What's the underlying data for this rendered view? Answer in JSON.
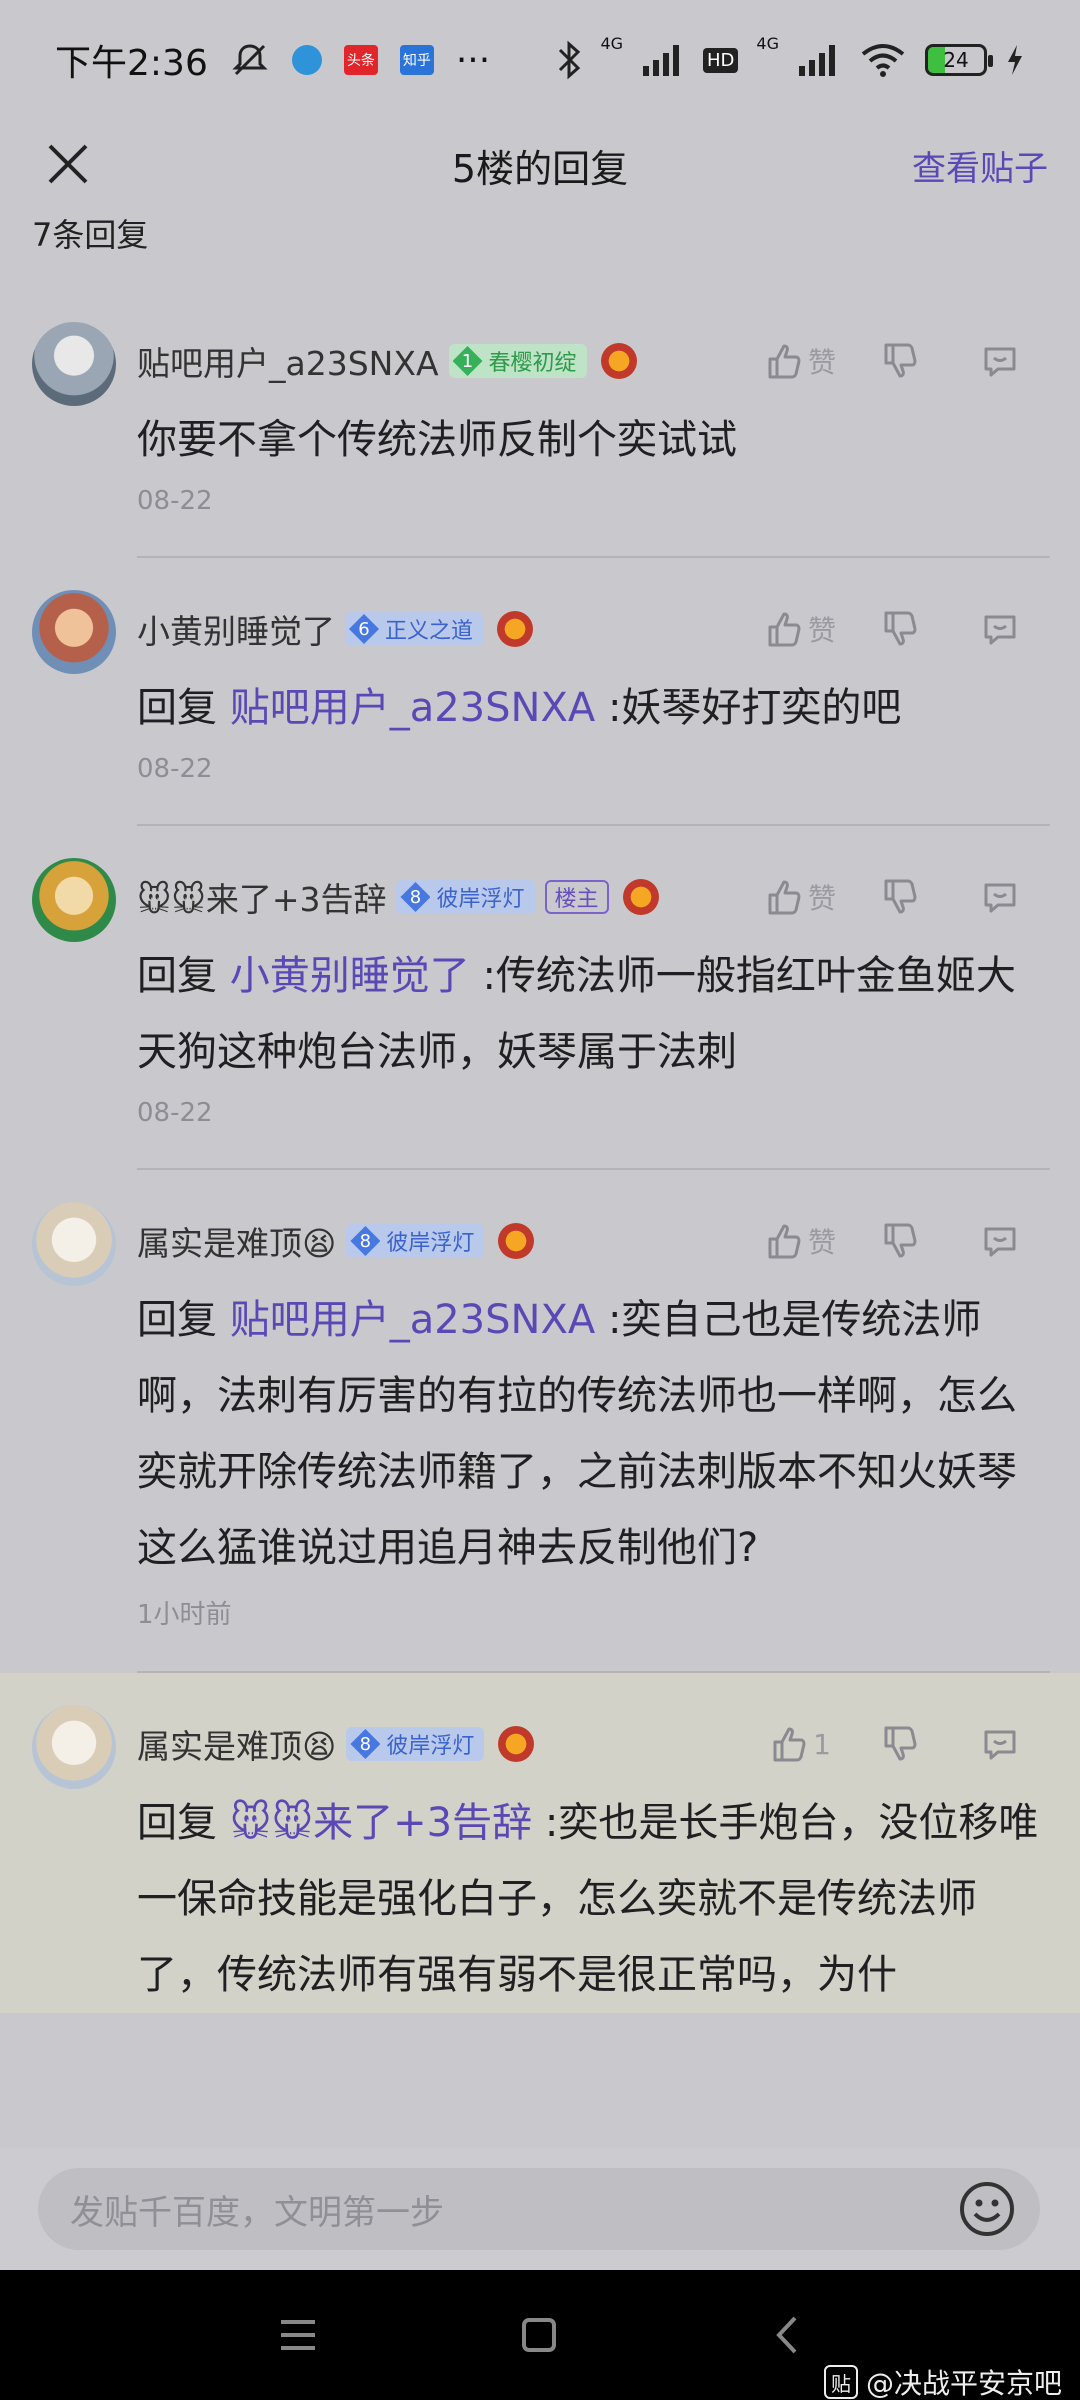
{
  "status_bar": {
    "time": "下午2:36",
    "app_badges": [
      "头条",
      "知乎"
    ],
    "overflow": "···",
    "network_1": "4G",
    "network_2": "4G",
    "hd": "HD",
    "battery": "24"
  },
  "header": {
    "title": "5楼的回复",
    "view_post": "查看贴子",
    "close_icon": "close-icon"
  },
  "reply_count": "7条回复",
  "like_label": "赞",
  "comments": [
    {
      "username": "贴吧用户_a23SNXA",
      "level": "1",
      "badge": "春樱初绽",
      "badge_style": "green",
      "owner": "",
      "reply_prefix": "",
      "mention": "",
      "text": "你要不拿个传统法师反制个奕试试",
      "time": "08-22",
      "likes": ""
    },
    {
      "username": "小黄别睡觉了",
      "level": "6",
      "badge": "正义之道",
      "badge_style": "blue",
      "owner": "",
      "reply_prefix": "回复",
      "mention": "贴吧用户_a23SNXA",
      "text": ":妖琴好打奕的吧",
      "time": "08-22",
      "likes": ""
    },
    {
      "username": "🐭🐭来了+3告辞",
      "level": "8",
      "badge": "彼岸浮灯",
      "badge_style": "blue",
      "owner": "楼主",
      "reply_prefix": "回复",
      "mention": "小黄别睡觉了",
      "text": ":传统法师一般指红叶金鱼姬大天狗这种炮台法师，妖琴属于法刺",
      "time": "08-22",
      "likes": ""
    },
    {
      "username": "属实是难顶😫",
      "level": "8",
      "badge": "彼岸浮灯",
      "badge_style": "blue",
      "owner": "",
      "reply_prefix": "回复",
      "mention": "贴吧用户_a23SNXA",
      "text": ":奕自己也是传统法师啊，法刺有厉害的有拉的传统法师也一样啊，怎么奕就开除传统法师籍了，之前法刺版本不知火妖琴这么猛谁说过用追月神去反制他们?",
      "time": "1小时前",
      "likes": ""
    },
    {
      "username": "属实是难顶😫",
      "level": "8",
      "badge": "彼岸浮灯",
      "badge_style": "blue",
      "owner": "",
      "reply_prefix": "回复",
      "mention": "🐭🐭来了+3告辞",
      "text": ":奕也是长手炮台，没位移唯一保命技能是强化白子，怎么奕就不是传统法师了，传统法师有强有弱不是很正常吗，为什",
      "time": "",
      "likes": "1"
    }
  ],
  "input": {
    "placeholder": "发贴千百度，文明第一步"
  },
  "watermark": {
    "logo": "贴",
    "text": "@决战平安京吧"
  },
  "colors": {
    "accent": "#5a49b5",
    "background": "#c9c9cd"
  }
}
